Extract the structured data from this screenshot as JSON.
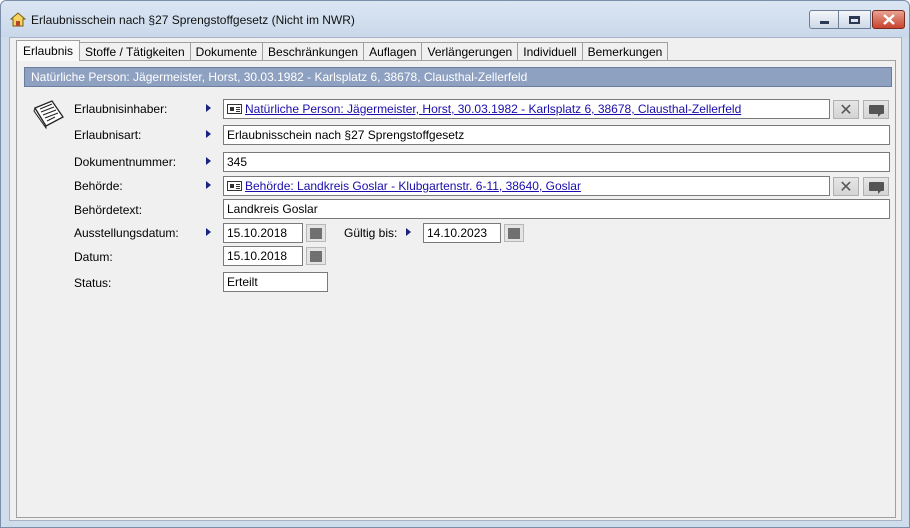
{
  "window": {
    "title": "Erlaubnisschein nach §27 Sprengstoffgesetz (Nicht im NWR)",
    "app_icon": "house-key-icon"
  },
  "tabs": [
    {
      "label": "Erlaubnis",
      "active": true
    },
    {
      "label": "Stoffe / Tätigkeiten",
      "active": false
    },
    {
      "label": "Dokumente",
      "active": false
    },
    {
      "label": "Beschränkungen",
      "active": false
    },
    {
      "label": "Auflagen",
      "active": false
    },
    {
      "label": "Verlängerungen",
      "active": false
    },
    {
      "label": "Individuell",
      "active": false
    },
    {
      "label": "Bemerkungen",
      "active": false
    }
  ],
  "header_bar": "Natürliche Person: Jägermeister, Horst, 30.03.1982 - Karlsplatz 6, 38678, Clausthal-Zellerfeld",
  "form": {
    "erlaubnisinhaber": {
      "label": "Erlaubnisinhaber:",
      "value": "Natürliche Person: Jägermeister, Horst, 30.03.1982 - Karlsplatz 6, 38678, Clausthal-Zellerfeld"
    },
    "erlaubnisart": {
      "label": "Erlaubnisart:",
      "value": "Erlaubnisschein nach §27 Sprengstoffgesetz"
    },
    "dokumentnummer": {
      "label": "Dokumentnummer:",
      "value": "345"
    },
    "behoerde": {
      "label": "Behörde:",
      "value": "Behörde: Landkreis Goslar - Klubgartenstr. 6-11, 38640, Goslar"
    },
    "behoerdetext": {
      "label": "Behördetext:",
      "value": "Landkreis Goslar"
    },
    "ausstellungsdatum": {
      "label": "Ausstellungsdatum:",
      "value": "15.10.2018"
    },
    "gueltig_bis": {
      "label": "Gültig bis:",
      "value": "14.10.2023"
    },
    "datum": {
      "label": "Datum:",
      "value": "15.10.2018"
    },
    "status": {
      "label": "Status:",
      "value": "Erteilt"
    }
  },
  "colors": {
    "header_bar": "#8fa1c1",
    "link": "#1a0dab",
    "arrow": "#1a237e",
    "close_button": "#c8432e"
  }
}
